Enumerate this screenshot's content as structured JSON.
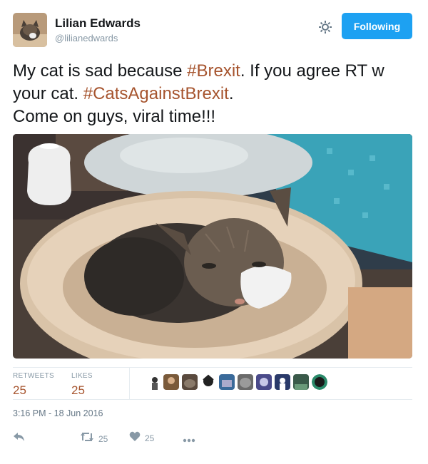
{
  "author": {
    "name": "Lilian Edwards",
    "handle": "@lilianedwards",
    "avatar_icon": "cat-photo-avatar"
  },
  "header": {
    "follow_label": "Following",
    "settings_icon": "gear-icon"
  },
  "tweet": {
    "segments": [
      {
        "text": "My cat is sad because ",
        "type": "text"
      },
      {
        "text": "#Brexit",
        "type": "hashtag"
      },
      {
        "text": ". If you agree RT w your cat. ",
        "type": "text"
      },
      {
        "text": "#CatsAgainstBrexit",
        "type": "hashtag"
      },
      {
        "text": ".",
        "type": "text"
      },
      {
        "text": "Come on guys, viral time!!!",
        "type": "text",
        "newline": true
      }
    ]
  },
  "stats": {
    "retweets_label": "RETWEETS",
    "retweets_count": "25",
    "likes_label": "LIKES",
    "likes_count": "25"
  },
  "timestamp": "3:16 PM - 18 Jun 2016",
  "actions": {
    "reply_icon": "reply-icon",
    "retweet_icon": "retweet-icon",
    "retweet_count": "25",
    "like_icon": "heart-icon",
    "like_count": "25",
    "more_icon": "more-icon"
  },
  "colors": {
    "link": "#a6542e",
    "follow_button": "#1da1f2",
    "muted": "#8899a6"
  }
}
